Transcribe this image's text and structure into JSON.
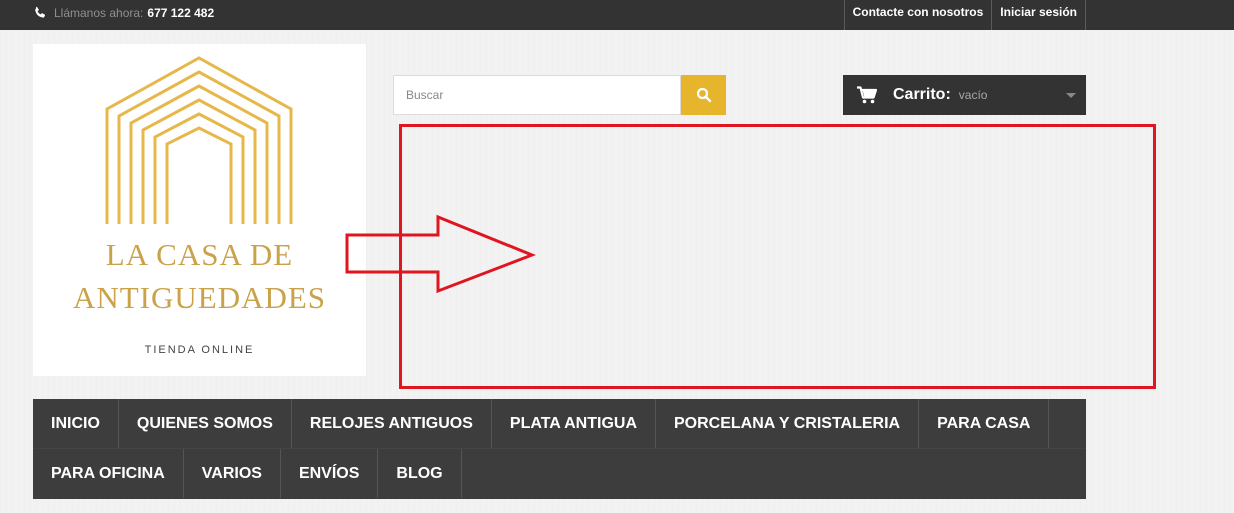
{
  "topbar": {
    "phone_label": "Llámanos ahora:",
    "phone_number": "677 122 482",
    "links": [
      "Contacte con nosotros",
      "Iniciar sesión"
    ]
  },
  "logo": {
    "line1": "LA CASA DE",
    "line2": "ANTIGUEDADES",
    "tagline": "TIENDA ONLINE",
    "color": "#c9a24a"
  },
  "search": {
    "placeholder": "Buscar",
    "button_icon": "search-icon",
    "button_color": "#e6b52c"
  },
  "cart": {
    "label": "Carrito:",
    "status": "vacío",
    "icon": "cart-icon"
  },
  "annotation": {
    "color": "#e1151f"
  },
  "nav": {
    "row1": [
      "INICIO",
      "QUIENES SOMOS",
      "RELOJES ANTIGUOS",
      "PLATA ANTIGUA",
      "PORCELANA Y CRISTALERIA",
      "PARA CASA"
    ],
    "row2": [
      "PARA OFICINA",
      "VARIOS",
      "ENVÍOS",
      "BLOG"
    ]
  }
}
